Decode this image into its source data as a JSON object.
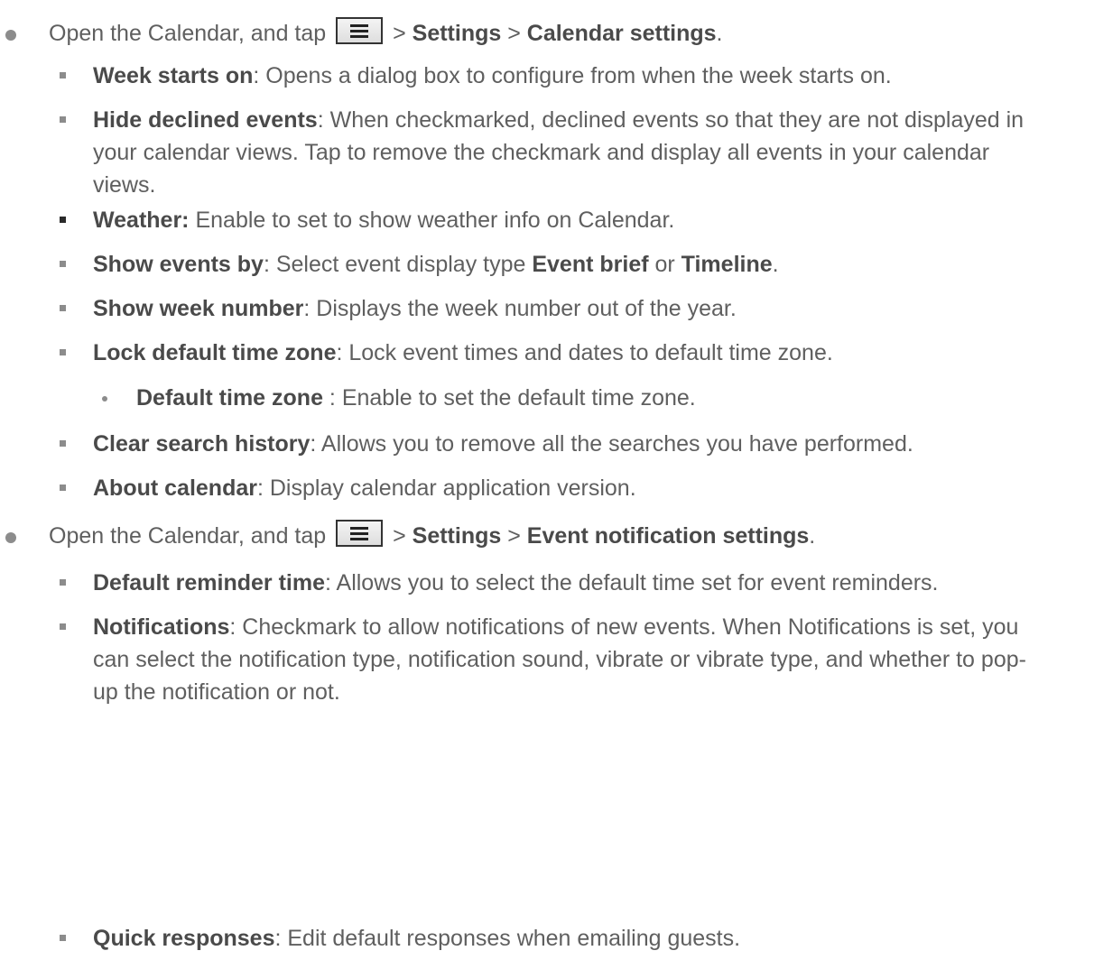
{
  "section1": {
    "intro": {
      "pre": "Open the Calendar, and tap",
      "gt1": " > ",
      "settings": "Settings",
      "gt2": " > ",
      "target": "Calendar settings",
      "end": "."
    },
    "items": [
      {
        "label": "Week starts on",
        "text": ": Opens a dialog box to configure from when the week starts on."
      },
      {
        "label": "Hide declined events",
        "text": ": When checkmarked, declined events so that they are not displayed in your calendar views. Tap to remove the checkmark and display all events in your calendar views."
      },
      {
        "label": "Weather:",
        "text": " Enable to set to show weather info on Calendar."
      },
      {
        "label": "Show events by",
        "text": ": Select event display type ",
        "b2": "Event brief",
        "mid": " or ",
        "b3": "Timeline",
        "end": "."
      },
      {
        "label": "Show week number",
        "text": ": Displays the week number out of the year."
      },
      {
        "label": "Lock default time zone",
        "text": ": Lock event times and dates to default time zone."
      },
      {
        "label": "Default time zone",
        "text": " : Enable to set the default time zone."
      },
      {
        "label": "Clear search history",
        "text": ": Allows you to remove all the searches you have performed."
      },
      {
        "label": "About calendar",
        "text": ": Display calendar application version."
      }
    ]
  },
  "section2": {
    "intro": {
      "pre": "Open the Calendar, and tap",
      "gt1": " > ",
      "settings": "Settings",
      "gt2": " > ",
      "target": "Event notification settings",
      "end": "."
    },
    "items": [
      {
        "label": "Default reminder time",
        "text": ": Allows you to select the default time set for event reminders."
      },
      {
        "label": "Notifications",
        "text": ": Checkmark to allow notifications of new events. When Notifications is set, you can select the notification type, notification sound, vibrate or vibrate type, and whether to pop-up the notification or not."
      },
      {
        "label": "Quick responses",
        "text": ": Edit default responses when emailing guests."
      }
    ]
  },
  "icons": {
    "menu": "menu-icon"
  }
}
